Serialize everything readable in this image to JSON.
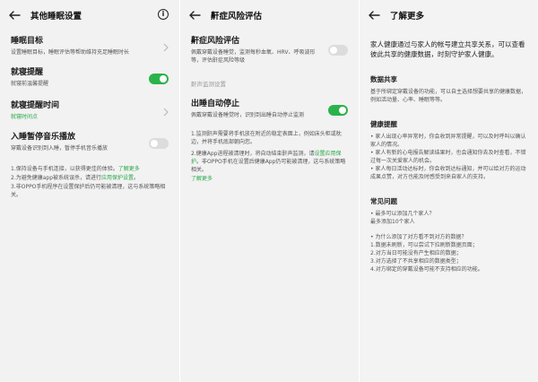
{
  "panel1": {
    "title": "其他睡眠设置",
    "info_icon": "i",
    "rows": [
      {
        "title": "睡眠目标",
        "subtitle": "设置睡眠目标，睡眠评估等帮助维持充足睡眠时长"
      },
      {
        "title": "就寝提醒",
        "subtitle": "就寝前温馨提醒"
      },
      {
        "title": "就寝提醒时间",
        "subtitle": "就寝时间点"
      },
      {
        "title": "入睡暂停音乐播放",
        "subtitle": "穿戴设备识别到入睡，暂停手机音乐播放"
      }
    ],
    "notes": {
      "line1_pre": "1.保持设备与手机连接，以获得更佳的体验。",
      "line1_link": "了解更多",
      "line2_pre": "2.为避免健康app被系统误杀，请进行",
      "line2_link": "应用保护设置",
      "line2_post": "。",
      "line3": "3.非OPPO手机程序在设置保护后仍可能被清理，这与系统策略相关。"
    }
  },
  "panel2": {
    "title": "鼾症风险评估",
    "row1": {
      "title": "鼾症风险评估",
      "subtitle": "佩戴穿戴设备睡觉，监测每秒血氧、HRV、呼吸波形等，评估鼾症风险等级"
    },
    "section_label": "鼾声监测设置",
    "row2": {
      "title": "出睡自动停止",
      "subtitle": "佩戴穿戴设备睡觉时，识别到出睡自动停止监测"
    },
    "notes": {
      "line1": "1.监测鼾声需要将手机放在附近的稳定表面上，例如床头柜或枕边，并将手机底部朝向您。",
      "line2_pre": "2.健康App进程被清理时，将自动结束鼾声监测，请",
      "line2_link": "设置应用保护",
      "line2_post": "。非OPPO手机在设置后健康App仍可能被清理，这与系统策略相关。",
      "more_link": "了解更多"
    }
  },
  "panel3": {
    "title": "了解更多",
    "intro": "家人健康通过与家人的帐号建立共享关系，可以查看彼此共享的健康数据，时刻守护家人健康。",
    "sec1_head": "数据共享",
    "sec1_text": "基于所绑定穿戴设备的功能，可以自主选择想要共享的健康数据，例如活动量、心率、睡眠等等。",
    "sec2_head": "健康提醒",
    "sec2_lines": [
      "• 家人出现心率异常时，你会收到异常提醒，可以及时呼叫以确认家人的情况。",
      "• 家人有新的心电报告解读结果时，也会通知你去及时查看，不错过每一次关爱家人的机会。",
      "• 家人每日活动达标时，你会收到达标通知，并可以给对方的运动成果点赞，对方也能及时感受到来自家人的支持。"
    ],
    "sec3_head": "常见问题",
    "faq1_q": "• 最多可以添加几个家人？",
    "faq1_a": "最多添加10个家人",
    "faq2_q": "• 为什么添加了对方看不到对方的数据？",
    "faq2_lines": [
      "1.数据未刷新，可以尝试下拉刷新数据页面；",
      "2.对方当日可能没有产生相应的数据；",
      "3.对方选择了不共享相应的数据类型；",
      "4.对方绑定的穿戴设备可能不支持相应的功能。"
    ]
  }
}
